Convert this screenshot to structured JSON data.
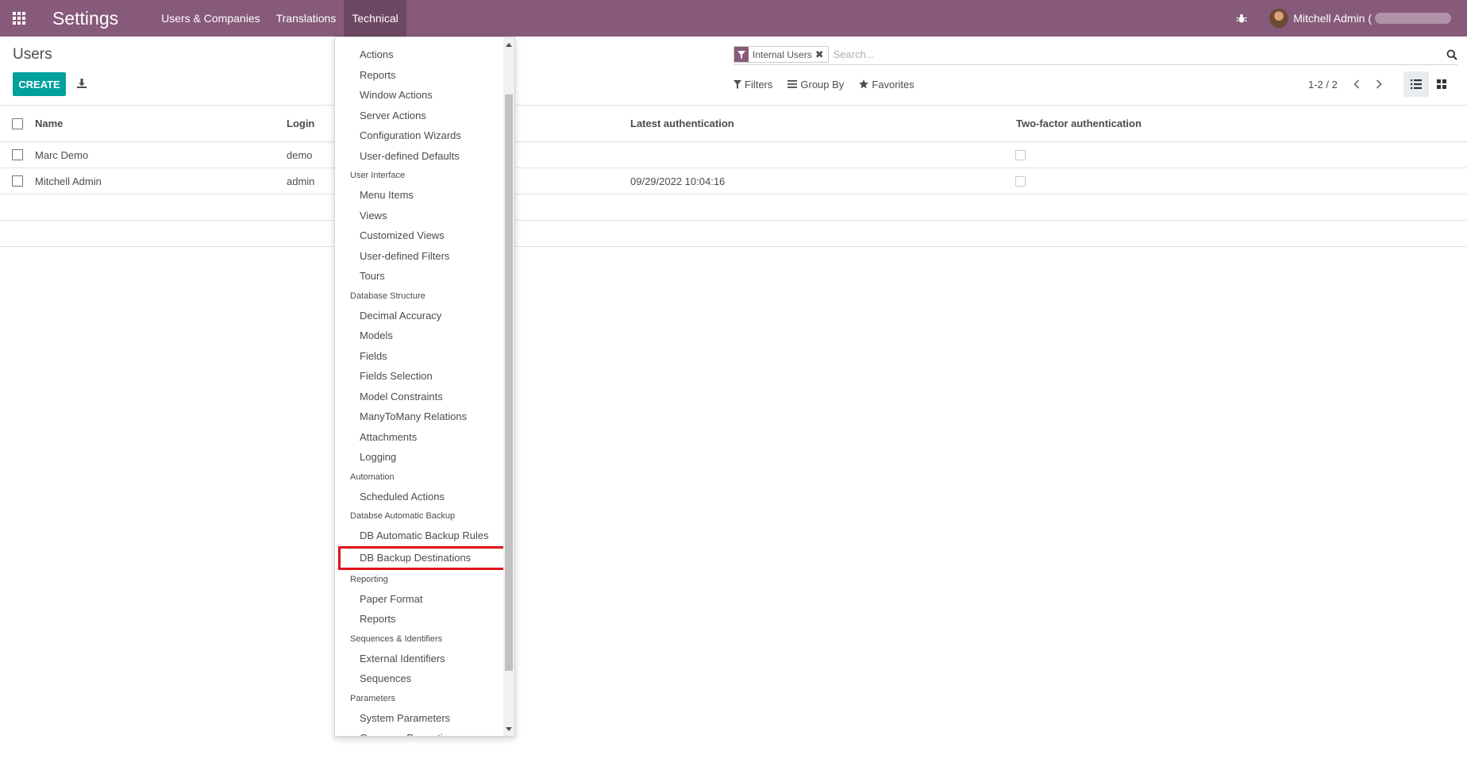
{
  "navbar": {
    "app_title": "Settings",
    "menu": [
      "Users & Companies",
      "Translations",
      "Technical"
    ],
    "active_menu": "Technical",
    "user_name": "Mitchell Admin (",
    "bg_color": "#875a7b"
  },
  "control_panel": {
    "title": "Users",
    "create_label": "CREATE",
    "search": {
      "facet_value": "Internal Users",
      "facet_remove": "✖",
      "placeholder": "Search..."
    },
    "filters_label": "Filters",
    "group_by_label": "Group By",
    "favorites_label": "Favorites",
    "pager": "1-2 / 2",
    "accent_color": "#00a09d"
  },
  "list": {
    "columns": {
      "name": "Name",
      "login": "Login",
      "latest_auth": "Latest authentication",
      "two_factor": "Two-factor authentication"
    },
    "rows": [
      {
        "name": "Marc Demo",
        "login": "demo",
        "latest_auth": ""
      },
      {
        "name": "Mitchell Admin",
        "login": "admin",
        "latest_auth": "09/29/2022 10:04:16"
      }
    ]
  },
  "technical_menu": {
    "highlight_color": "#e0121b",
    "entries": [
      {
        "type": "item",
        "label": "Actions"
      },
      {
        "type": "item",
        "label": "Reports"
      },
      {
        "type": "item",
        "label": "Window Actions"
      },
      {
        "type": "item",
        "label": "Server Actions"
      },
      {
        "type": "item",
        "label": "Configuration Wizards"
      },
      {
        "type": "item",
        "label": "User-defined Defaults"
      },
      {
        "type": "header",
        "label": "User Interface"
      },
      {
        "type": "item",
        "label": "Menu Items"
      },
      {
        "type": "item",
        "label": "Views"
      },
      {
        "type": "item",
        "label": "Customized Views"
      },
      {
        "type": "item",
        "label": "User-defined Filters"
      },
      {
        "type": "item",
        "label": "Tours"
      },
      {
        "type": "header",
        "label": "Database Structure"
      },
      {
        "type": "item",
        "label": "Decimal Accuracy"
      },
      {
        "type": "item",
        "label": "Models"
      },
      {
        "type": "item",
        "label": "Fields"
      },
      {
        "type": "item",
        "label": "Fields Selection"
      },
      {
        "type": "item",
        "label": "Model Constraints"
      },
      {
        "type": "item",
        "label": "ManyToMany Relations"
      },
      {
        "type": "item",
        "label": "Attachments"
      },
      {
        "type": "item",
        "label": "Logging"
      },
      {
        "type": "header",
        "label": "Automation"
      },
      {
        "type": "item",
        "label": "Scheduled Actions"
      },
      {
        "type": "header",
        "label": "Databse Automatic Backup"
      },
      {
        "type": "item",
        "label": "DB Automatic Backup Rules"
      },
      {
        "type": "item",
        "label": "DB Backup Destinations",
        "highlighted": true
      },
      {
        "type": "header",
        "label": "Reporting"
      },
      {
        "type": "item",
        "label": "Paper Format"
      },
      {
        "type": "item",
        "label": "Reports"
      },
      {
        "type": "header",
        "label": "Sequences & Identifiers"
      },
      {
        "type": "item",
        "label": "External Identifiers"
      },
      {
        "type": "item",
        "label": "Sequences"
      },
      {
        "type": "header",
        "label": "Parameters"
      },
      {
        "type": "item",
        "label": "System Parameters"
      },
      {
        "type": "item",
        "label": "Company Properties"
      }
    ]
  }
}
